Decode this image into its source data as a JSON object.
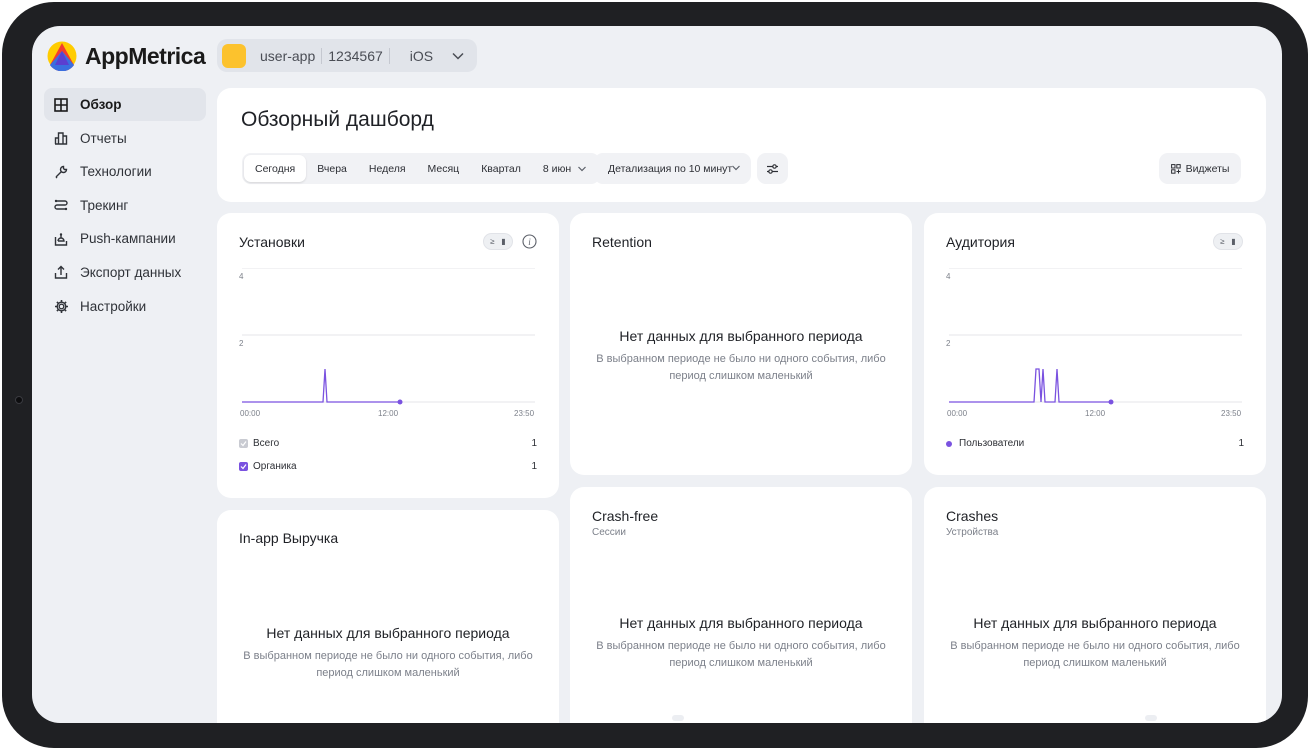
{
  "app": {
    "logo_text": "AppMetrica",
    "app_name": "user-app",
    "app_id": "1234567",
    "platform": "iOS"
  },
  "sidebar": {
    "items": [
      {
        "label": "Обзор",
        "icon": "grid-icon"
      },
      {
        "label": "Отчеты",
        "icon": "bar-chart-icon"
      },
      {
        "label": "Технологии",
        "icon": "wrench-icon"
      },
      {
        "label": "Трекинг",
        "icon": "route-icon"
      },
      {
        "label": "Push-кампании",
        "icon": "bell-icon"
      },
      {
        "label": "Экспорт данных",
        "icon": "upload-icon"
      },
      {
        "label": "Настройки",
        "icon": "gear-icon"
      }
    ]
  },
  "header": {
    "title": "Обзорный дашборд",
    "periods": [
      "Сегодня",
      "Вчера",
      "Неделя",
      "Месяц",
      "Квартал",
      "8 июн"
    ],
    "detail": "Детализация по 10 минут",
    "widgets_label": "Виджеты"
  },
  "installs": {
    "title": "Установки",
    "toggle": [
      "≥",
      "▮"
    ],
    "y_ticks": [
      "4",
      "2"
    ],
    "x_ticks": [
      "00:00",
      "12:00",
      "23:50"
    ],
    "legend": [
      {
        "label": "Всего",
        "value": "1"
      },
      {
        "label": "Органика",
        "value": "1"
      }
    ]
  },
  "retention": {
    "title": "Retention",
    "empty_title": "Нет данных для выбранного периода",
    "empty_line1": "В выбранном периоде не было ни одного события, либо",
    "empty_line2": "период слишком маленький"
  },
  "audience": {
    "title": "Аудитория",
    "toggle": [
      "≥",
      "▮"
    ],
    "y_ticks": [
      "4",
      "2"
    ],
    "x_ticks": [
      "00:00",
      "12:00",
      "23:50"
    ],
    "legend": [
      {
        "label": "Пользователи",
        "value": "1"
      }
    ]
  },
  "revenue": {
    "title": "In-app Выручка",
    "empty_title": "Нет данных для выбранного периода",
    "empty_line1": "В выбранном периоде не было ни одного события, либо",
    "empty_line2": "период слишком маленький"
  },
  "crashfree": {
    "title": "Crash-free",
    "subtitle": "Сессии",
    "empty_title": "Нет данных для выбранного периода",
    "empty_line1": "В выбранном периоде не было ни одного события, либо",
    "empty_line2": "период слишком маленький"
  },
  "crashes": {
    "title": "Crashes",
    "subtitle": "Устройства",
    "empty_title": "Нет данных для выбранного периода",
    "empty_line1": "В выбранном периоде не было ни одного события, либо",
    "empty_line2": "период слишком маленький"
  },
  "colors": {
    "accent": "#7a52e0",
    "background": "#eef0f4",
    "card": "#ffffff",
    "logo_yellow": "#fcc22d"
  }
}
